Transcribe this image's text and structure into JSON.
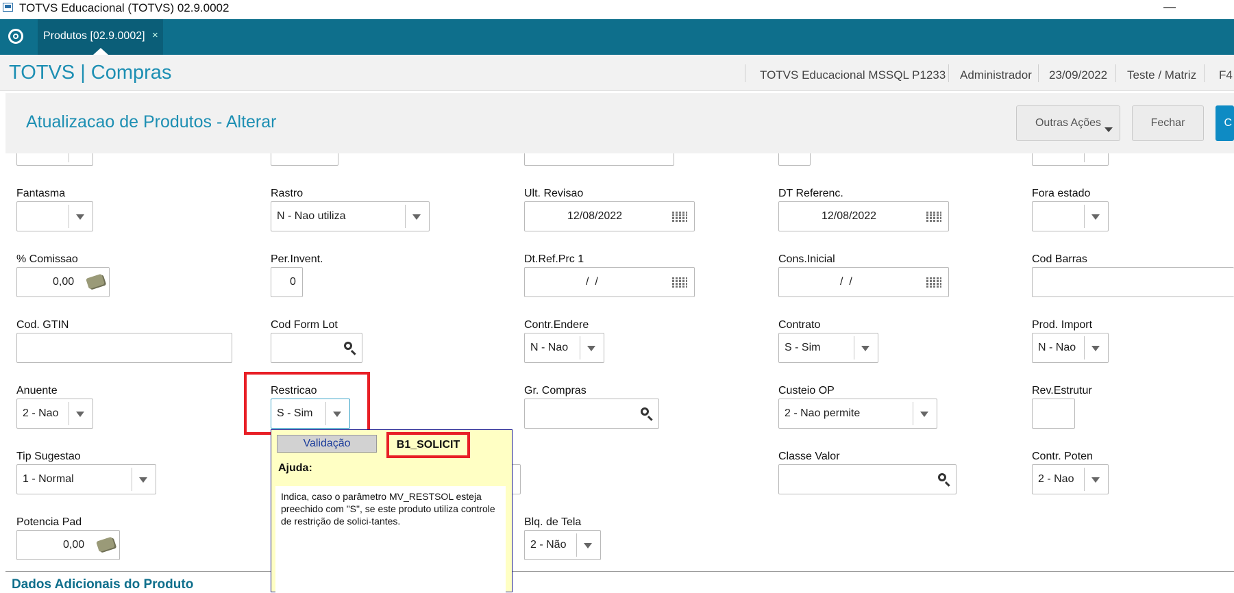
{
  "window": {
    "title": "TOTVS Educacional (TOTVS) 02.9.0002",
    "minimize": "—"
  },
  "tabbar": {
    "tab_label": "Produtos [02.9.0002]",
    "tab_close": "×"
  },
  "header": {
    "app_title": "TOTVS | Compras",
    "environment": "TOTVS Educacional MSSQL P1233",
    "user": "Administrador",
    "date": "23/09/2022",
    "branch": "Teste / Matriz",
    "shortcut": "F4"
  },
  "page": {
    "title": "Atualizacao de Produtos - Alterar",
    "actions": {
      "outras": "Outras Ações",
      "fechar": "Fechar",
      "confirmar": "C"
    }
  },
  "fields": {
    "fantasma": {
      "label": "Fantasma",
      "value": ""
    },
    "rastro": {
      "label": "Rastro",
      "value": "N - Nao utiliza"
    },
    "ult_revisao": {
      "label": "Ult. Revisao",
      "value": "12/08/2022"
    },
    "dt_referenc": {
      "label": "DT Referenc.",
      "value": "12/08/2022"
    },
    "fora_estado": {
      "label": "Fora estado",
      "value": ""
    },
    "comissao": {
      "label": "% Comissao",
      "value": "0,00"
    },
    "per_invent": {
      "label": "Per.Invent.",
      "value": "0"
    },
    "dt_ref_prc1": {
      "label": "Dt.Ref.Prc 1",
      "value": "/  /"
    },
    "cons_inicial": {
      "label": "Cons.Inicial",
      "value": "/  /"
    },
    "cod_barras": {
      "label": "Cod Barras",
      "value": ""
    },
    "cod_gtin": {
      "label": "Cod. GTIN",
      "value": ""
    },
    "cod_form_lot": {
      "label": "Cod Form Lot",
      "value": ""
    },
    "contr_endere": {
      "label": "Contr.Endere",
      "value": "N - Nao"
    },
    "contrato": {
      "label": "Contrato",
      "value": "S - Sim"
    },
    "prod_import": {
      "label": "Prod. Import",
      "value": "N - Nao"
    },
    "anuente": {
      "label": "Anuente",
      "value": "2 - Nao"
    },
    "restricao": {
      "label": "Restricao",
      "value": "S - Sim"
    },
    "gr_compras": {
      "label": "Gr. Compras",
      "value": ""
    },
    "custeio_op": {
      "label": "Custeio OP",
      "value": "2 - Nao permite"
    },
    "rev_estrutur": {
      "label": "Rev.Estrutur",
      "value": ""
    },
    "tip_sugestao": {
      "label": "Tip Sugestao",
      "value": "1 - Normal"
    },
    "classe_valor": {
      "label": "Classe Valor",
      "value": ""
    },
    "contr_poten": {
      "label": "Contr. Poten",
      "value": "2 - Nao"
    },
    "potencia_pad": {
      "label": "Potencia Pad",
      "value": "0,00"
    },
    "blq_tela": {
      "label": "Blq. de Tela",
      "value": "2 - Não"
    }
  },
  "popup": {
    "tab_validacao": "Validação",
    "tab_field": "B1_SOLICIT",
    "ajuda_label": "Ajuda:",
    "help_text": "Indica, caso o parâmetro MV_RESTSOL esteja preechido com \"S\", se este produto utiliza controle de restrição de solici-tantes."
  },
  "section": {
    "title": "Dados Adicionais do Produto"
  },
  "colors": {
    "tabbar": "#0e6f8c",
    "accent": "#1d8fb3",
    "highlight": "#e81f26",
    "popup_bg": "#ffffc4"
  }
}
